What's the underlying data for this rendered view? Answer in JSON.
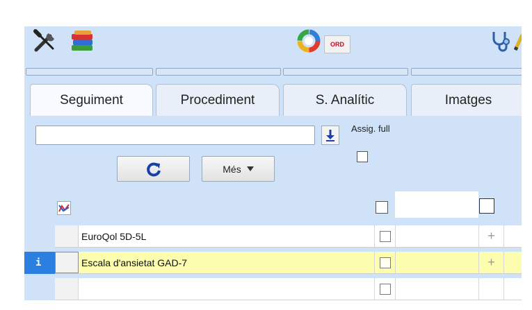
{
  "toolbar": {
    "ord_label": "ORD",
    "icons": [
      "tools-icon",
      "books-icon",
      "cycle-icon",
      "stethoscope-icon",
      "pen-icon"
    ]
  },
  "tabs": [
    {
      "label": "Seguiment"
    },
    {
      "label": "Procediment"
    },
    {
      "label": "S. Analític"
    },
    {
      "label": "Imatges"
    }
  ],
  "search": {
    "value": "",
    "placeholder": ""
  },
  "assig_full": {
    "label": "Assig. full",
    "checked": false
  },
  "buttons": {
    "refresh": "C",
    "mes": "Més"
  },
  "grid": {
    "header_icon": "chart-icon",
    "rows": [
      {
        "label": "EuroQol 5D-5L",
        "highlighted": false,
        "info": "",
        "action": "+"
      },
      {
        "label": "Escala d'ansietat GAD-7",
        "highlighted": true,
        "info": "i",
        "action": "+"
      },
      {
        "label": "",
        "highlighted": false,
        "info": "",
        "action": ""
      }
    ]
  },
  "colors": {
    "panel_bg": "#cfe2f7",
    "highlight_row": "#fdfdb0",
    "info_blue": "#2a7fe0"
  }
}
